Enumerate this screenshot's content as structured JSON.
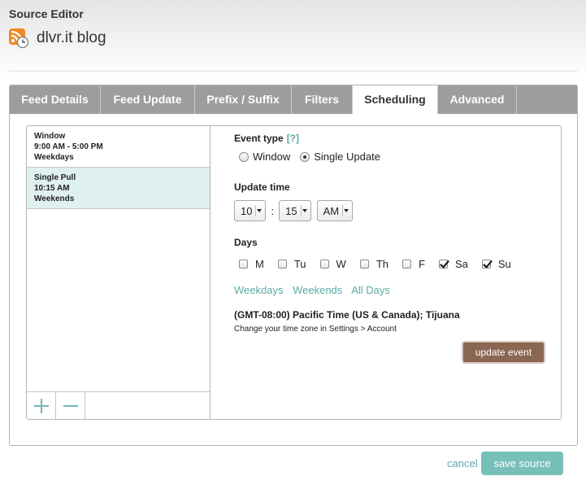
{
  "header": {
    "title": "Source Editor",
    "feed_name": "dlvr.it blog",
    "feed_icon": "rss-icon"
  },
  "tabs": [
    {
      "label": "Feed Details",
      "active": false
    },
    {
      "label": "Feed Update",
      "active": false
    },
    {
      "label": "Prefix / Suffix",
      "active": false
    },
    {
      "label": "Filters",
      "active": false
    },
    {
      "label": "Scheduling",
      "active": true
    },
    {
      "label": "Advanced",
      "active": false
    }
  ],
  "events": [
    {
      "type": "Window",
      "time": "9:00 AM - 5:00 PM",
      "days": "Weekdays",
      "selected": false
    },
    {
      "type": "Single Pull",
      "time": "10:15 AM",
      "days": "Weekends",
      "selected": true
    }
  ],
  "list_controls": {
    "add_icon": "plus-icon",
    "remove_icon": "minus-icon"
  },
  "form": {
    "event_type_label": "Event type",
    "help_link": "[?]",
    "event_type_options": [
      {
        "label": "Window",
        "checked": false
      },
      {
        "label": "Single Update",
        "checked": true
      }
    ],
    "update_time_label": "Update time",
    "hour": "10",
    "minute": "15",
    "ampm": "AM",
    "time_separator": ":",
    "days_label": "Days",
    "days": [
      {
        "label": "M",
        "checked": false
      },
      {
        "label": "Tu",
        "checked": false
      },
      {
        "label": "W",
        "checked": false
      },
      {
        "label": "Th",
        "checked": false
      },
      {
        "label": "F",
        "checked": false
      },
      {
        "label": "Sa",
        "checked": true
      },
      {
        "label": "Su",
        "checked": true
      }
    ],
    "quick_links": [
      "Weekdays",
      "Weekends",
      "All Days"
    ],
    "timezone": "(GMT-08:00) Pacific Time (US & Canada); Tijuana",
    "timezone_note": "Change your time zone in Settings > Account",
    "update_button": "update event"
  },
  "footer": {
    "cancel_label": "cancel",
    "save_label": "save source"
  },
  "colors": {
    "accent": "#5aaaa6",
    "save_button": "#77bfb9",
    "update_button": "#8b6653",
    "selected_row": "#dff0ee",
    "tab_bar": "#9d9d9d"
  }
}
